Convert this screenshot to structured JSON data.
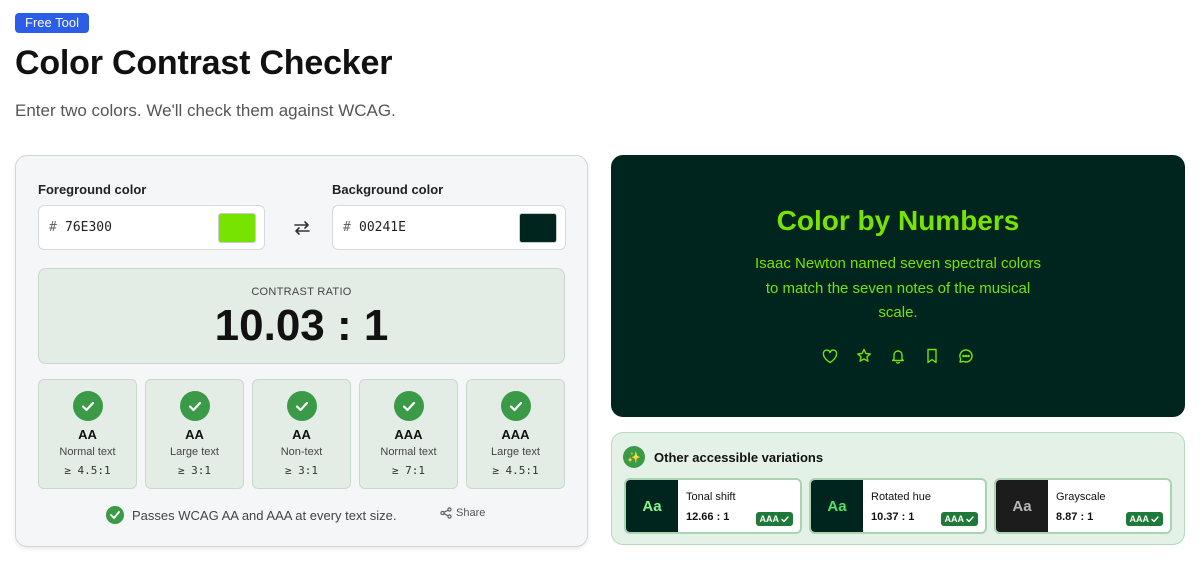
{
  "header": {
    "badge": "Free Tool",
    "title": "Color Contrast Checker",
    "subtitle": "Enter two colors. We'll check them against WCAG."
  },
  "inputs": {
    "foreground": {
      "label": "Foreground color",
      "prefix": "#",
      "value": "76E300",
      "swatch": "#76e300"
    },
    "background": {
      "label": "Background color",
      "prefix": "#",
      "value": "00241E",
      "swatch": "#00241e"
    },
    "swap_icon": "swap-arrows-icon"
  },
  "contrast": {
    "label": "CONTRAST RATIO",
    "value": "10.03 : 1"
  },
  "checks": [
    {
      "level": "AA",
      "kind": "Normal text",
      "requirement": "≥ 4.5:1",
      "passed": true
    },
    {
      "level": "AA",
      "kind": "Large text",
      "requirement": "≥ 3:1",
      "passed": true
    },
    {
      "level": "AA",
      "kind": "Non-text",
      "requirement": "≥ 3:1",
      "passed": true
    },
    {
      "level": "AAA",
      "kind": "Normal text",
      "requirement": "≥ 7:1",
      "passed": true
    },
    {
      "level": "AAA",
      "kind": "Large text",
      "requirement": "≥ 4.5:1",
      "passed": true
    }
  ],
  "summary": {
    "text": "Passes WCAG AA and AAA at every text size.",
    "share_label": "Share"
  },
  "preview": {
    "title": "Color by Numbers",
    "body": "Isaac Newton named seven spectral colors to match the seven notes of the musical scale.",
    "icons": [
      "heart-icon",
      "star-icon",
      "bell-icon",
      "bookmark-icon",
      "chat-icon"
    ],
    "fg": "#76e300",
    "bg": "#00241e"
  },
  "variations": {
    "title": "Other accessible variations",
    "items": [
      {
        "name": "Tonal shift",
        "ratio": "12.66 : 1",
        "badge": "AAA",
        "sample": "Aa",
        "fg": "#86f58a",
        "bg": "#00241e"
      },
      {
        "name": "Rotated hue",
        "ratio": "10.37 : 1",
        "badge": "AAA",
        "sample": "Aa",
        "fg": "#4ee36c",
        "bg": "#00241e"
      },
      {
        "name": "Grayscale",
        "ratio": "8.87 : 1",
        "badge": "AAA",
        "sample": "Aa",
        "fg": "#b8b8b8",
        "bg": "#1c1c1c"
      }
    ]
  }
}
